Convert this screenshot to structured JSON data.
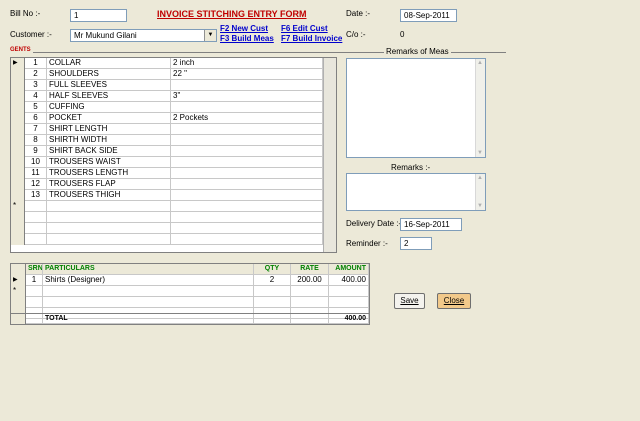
{
  "header": {
    "bill_no_label": "Bill No :-",
    "bill_no_value": "1",
    "title": "INVOICE STITCHING ENTRY FORM",
    "date_label": "Date :-",
    "date_value": "08-Sep-2011",
    "customer_label": "Customer :-",
    "customer_value": "Mr Mukund Gilani",
    "co_label": "C/o :-",
    "co_value": "0"
  },
  "hotkeys": {
    "f2": "F2 New Cust",
    "f3": "F3 Build Meas",
    "f6": "F6 Edit Cust",
    "f7": "F7 Build Invoice"
  },
  "measurements": {
    "section_label": "GENTS",
    "rows": [
      {
        "num": "1",
        "name": "COLLAR",
        "value": "2 inch"
      },
      {
        "num": "2",
        "name": "SHOULDERS",
        "value": "22 \""
      },
      {
        "num": "3",
        "name": "FULL SLEEVES",
        "value": ""
      },
      {
        "num": "4",
        "name": "HALF SLEEVES",
        "value": "3\""
      },
      {
        "num": "5",
        "name": "CUFFING",
        "value": ""
      },
      {
        "num": "6",
        "name": "POCKET",
        "value": "2 Pockets"
      },
      {
        "num": "7",
        "name": "SHIRT LENGTH",
        "value": ""
      },
      {
        "num": "8",
        "name": "SHIRTH WIDTH",
        "value": ""
      },
      {
        "num": "9",
        "name": "SHIRT BACK SIDE",
        "value": ""
      },
      {
        "num": "10",
        "name": "TROUSERS WAIST",
        "value": ""
      },
      {
        "num": "11",
        "name": "TROUSERS LENGTH",
        "value": ""
      },
      {
        "num": "12",
        "name": "TROUSERS FLAP",
        "value": ""
      },
      {
        "num": "13",
        "name": "TROUSERS THIGH",
        "value": ""
      }
    ]
  },
  "remarks": {
    "meas_label": "Remarks of Meas",
    "remarks_label": "Remarks :-",
    "delivery_label": "Delivery Date :-",
    "delivery_value": "16-Sep-2011",
    "reminder_label": "Reminder :-",
    "reminder_value": "2"
  },
  "invoice": {
    "columns": {
      "srn": "SRN",
      "particulars": "PARTICULARS",
      "qty": "QTY",
      "rate": "RATE",
      "amount": "AMOUNT"
    },
    "rows": [
      {
        "srn": "1",
        "particulars": "Shirts (Designer)",
        "qty": "2",
        "rate": "200.00",
        "amount": "400.00"
      }
    ],
    "total_label": "TOTAL",
    "total_amount": "400.00"
  },
  "buttons": {
    "save": "Save",
    "close": "Close"
  },
  "colors": {
    "title": "#C00000",
    "hotkey": "#0000CC",
    "header_text": "#008000",
    "close_button": "#F2C98A"
  }
}
